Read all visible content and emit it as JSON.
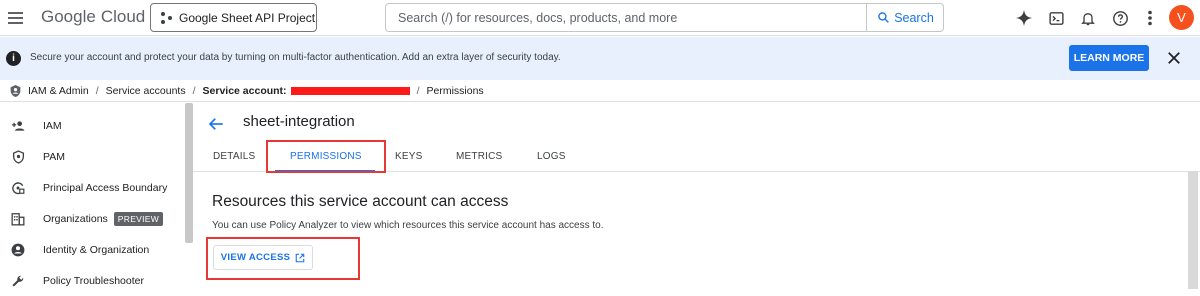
{
  "header": {
    "logo_google": "Google",
    "logo_cloud": "Cloud",
    "project": "Google Sheet API Project",
    "search_placeholder": "Search (/) for resources, docs, products, and more",
    "search_button": "Search",
    "avatar_letter": "V"
  },
  "banner": {
    "message": "Secure your account and protect your data by turning on multi-factor authentication. Add an extra layer of security today.",
    "learn_more": "LEARN MORE"
  },
  "breadcrumb": {
    "iam_admin": "IAM & Admin",
    "service_accounts": "Service accounts",
    "service_account_label": "Service account:",
    "permissions": "Permissions"
  },
  "sidebar": {
    "items": [
      {
        "label": "IAM",
        "icon": "person-add-icon"
      },
      {
        "label": "PAM",
        "icon": "shield-icon"
      },
      {
        "label": "Principal Access Boundary",
        "icon": "boundary-icon"
      },
      {
        "label": "Organizations",
        "icon": "building-icon",
        "badge": "PREVIEW"
      },
      {
        "label": "Identity & Organization",
        "icon": "account-circle-icon"
      },
      {
        "label": "Policy Troubleshooter",
        "icon": "wrench-icon"
      }
    ]
  },
  "main": {
    "title": "sheet-integration",
    "tabs": [
      "DETAILS",
      "PERMISSIONS",
      "KEYS",
      "METRICS",
      "LOGS"
    ],
    "active_tab": "PERMISSIONS",
    "section_title": "Resources this service account can access",
    "section_desc": "You can use Policy Analyzer to view which resources this service account has access to.",
    "view_access": "VIEW ACCESS"
  },
  "colors": {
    "accent": "#1a73e8",
    "banner_bg": "#e8f0fe",
    "highlight": "#e53935",
    "avatar": "#f4511e"
  }
}
